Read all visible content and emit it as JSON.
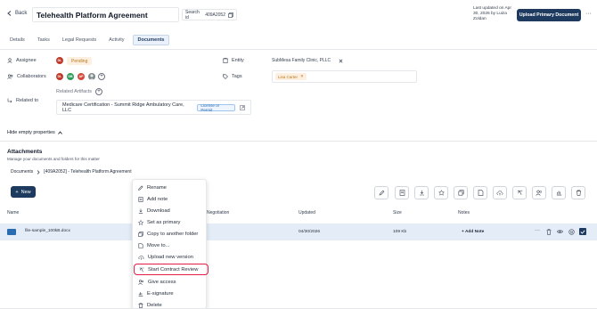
{
  "header": {
    "back_label": "Back",
    "title": "Telehealth Platform Agreement",
    "search_id_label": "Search id",
    "search_id_value": "409A2052",
    "updated_text": "Last updated on Apr 30, 2026 by Luiza Zoldan",
    "upload_button": "Upload Primary Document",
    "more": "···"
  },
  "tabs": [
    "Details",
    "Tasks",
    "Legal Requests",
    "Activity",
    "Documents"
  ],
  "active_tab": "Documents",
  "properties": {
    "assignee_label": "Assignee",
    "assignee_initials": "DL",
    "assignee_status": "Pending",
    "collaborators_label": "Collaborators",
    "collaborators": [
      {
        "initials": "DL",
        "color": "#c0392b"
      },
      {
        "initials": "DB",
        "color": "#2e9d5b"
      },
      {
        "initials": "AP",
        "color": "#d4493b"
      },
      {
        "initials": "",
        "color": "#7f8c8d"
      }
    ],
    "related_to_label": "Related to",
    "related_artifacts_label": "Related Artifacts",
    "related_item": "Medicare Certification - Summit Ridge Ambulatory Care, LLC",
    "related_item_type": "License or Permit",
    "entity_label": "Entity",
    "entity_value": "SubMesa Family Clinic, PLLC",
    "tags_label": "Tags",
    "tag_value": "Lisa Carter"
  },
  "hide_empty": "Hide empty properties",
  "attachments": {
    "title": "Attachments",
    "subtitle": "Manage your documents and folders for this matter",
    "breadcrumb_root": "Documents",
    "breadcrumb_current": "[409A2052] - Telehealth Platform Agreement",
    "new_button": "New"
  },
  "table": {
    "columns": [
      "Name",
      "Negotiation",
      "Updated",
      "Size",
      "Notes"
    ],
    "rows": [
      {
        "name": "file-sample_100kB.docx",
        "negotiation": "",
        "updated": "04/30/2026",
        "size": "109 Kb",
        "notes": "+ Add Note"
      }
    ]
  },
  "context_menu": [
    {
      "label": "Rename",
      "icon": "pencil-icon"
    },
    {
      "label": "Add note",
      "icon": "note-icon"
    },
    {
      "label": "Download",
      "icon": "download-icon"
    },
    {
      "label": "Set as primary",
      "icon": "star-icon"
    },
    {
      "label": "Copy to another folder",
      "icon": "copy-icon"
    },
    {
      "label": "Move to...",
      "icon": "move-icon"
    },
    {
      "label": "Upload new version",
      "icon": "upload-icon"
    },
    {
      "label": "Start Contract Review",
      "icon": "review-icon"
    },
    {
      "label": "Give access",
      "icon": "people-icon"
    },
    {
      "label": "E-signature",
      "icon": "signature-icon"
    },
    {
      "label": "Delete",
      "icon": "trash-icon"
    }
  ],
  "highlighted_menu_item": "Start Contract Review",
  "colors": {
    "primary": "#1f3a5f",
    "pending_bg": "#fdf0e1",
    "pending_text": "#b7791f",
    "selected_row": "#e4edf7",
    "highlight_border": "#e11d48"
  }
}
